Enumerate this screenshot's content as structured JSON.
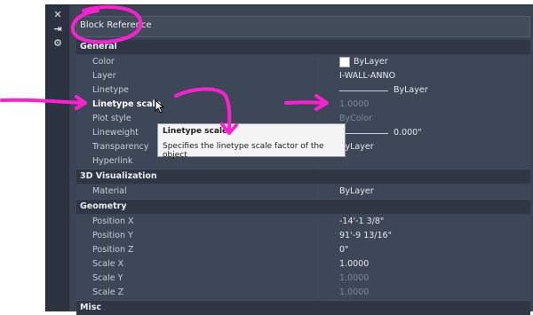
{
  "toolbar": {
    "close_glyph": "✕",
    "pin_glyph": "⇥",
    "settings_glyph": "⚙"
  },
  "selection": {
    "value": "Block Reference"
  },
  "sections": {
    "general": {
      "title": "General",
      "rows": {
        "color": {
          "label": "Color",
          "value": "ByLayer"
        },
        "layer": {
          "label": "Layer",
          "value": "I-WALL-ANNO"
        },
        "linetype": {
          "label": "Linetype",
          "value": "ByLayer"
        },
        "linetype_scale": {
          "label": "Linetype scale",
          "value": "1.0000"
        },
        "plot_style": {
          "label": "Plot style",
          "value": "ByColor"
        },
        "lineweight": {
          "label": "Lineweight",
          "value": "0.000\""
        },
        "transparency": {
          "label": "Transparency",
          "value": "ByLayer"
        },
        "hyperlink": {
          "label": "Hyperlink",
          "value": ""
        }
      }
    },
    "visualization": {
      "title": "3D Visualization",
      "rows": {
        "material": {
          "label": "Material",
          "value": "ByLayer"
        }
      }
    },
    "geometry": {
      "title": "Geometry",
      "rows": {
        "position_x": {
          "label": "Position X",
          "value": "-14'-1 3/8\""
        },
        "position_y": {
          "label": "Position Y",
          "value": "91'-9 13/16\""
        },
        "position_z": {
          "label": "Position Z",
          "value": "0\""
        },
        "scale_x": {
          "label": "Scale X",
          "value": "1.0000"
        },
        "scale_y": {
          "label": "Scale Y",
          "value": "1.0000"
        },
        "scale_z": {
          "label": "Scale Z",
          "value": "1.0000"
        }
      }
    },
    "misc": {
      "title": "Misc"
    }
  },
  "tooltip": {
    "title": "Linetype scale",
    "body": "Specifies the linetype scale factor of the object"
  },
  "colors": {
    "panel_bg": "#3b4453",
    "section_bg": "#2f3644",
    "annotation": "#ff1fd2"
  }
}
